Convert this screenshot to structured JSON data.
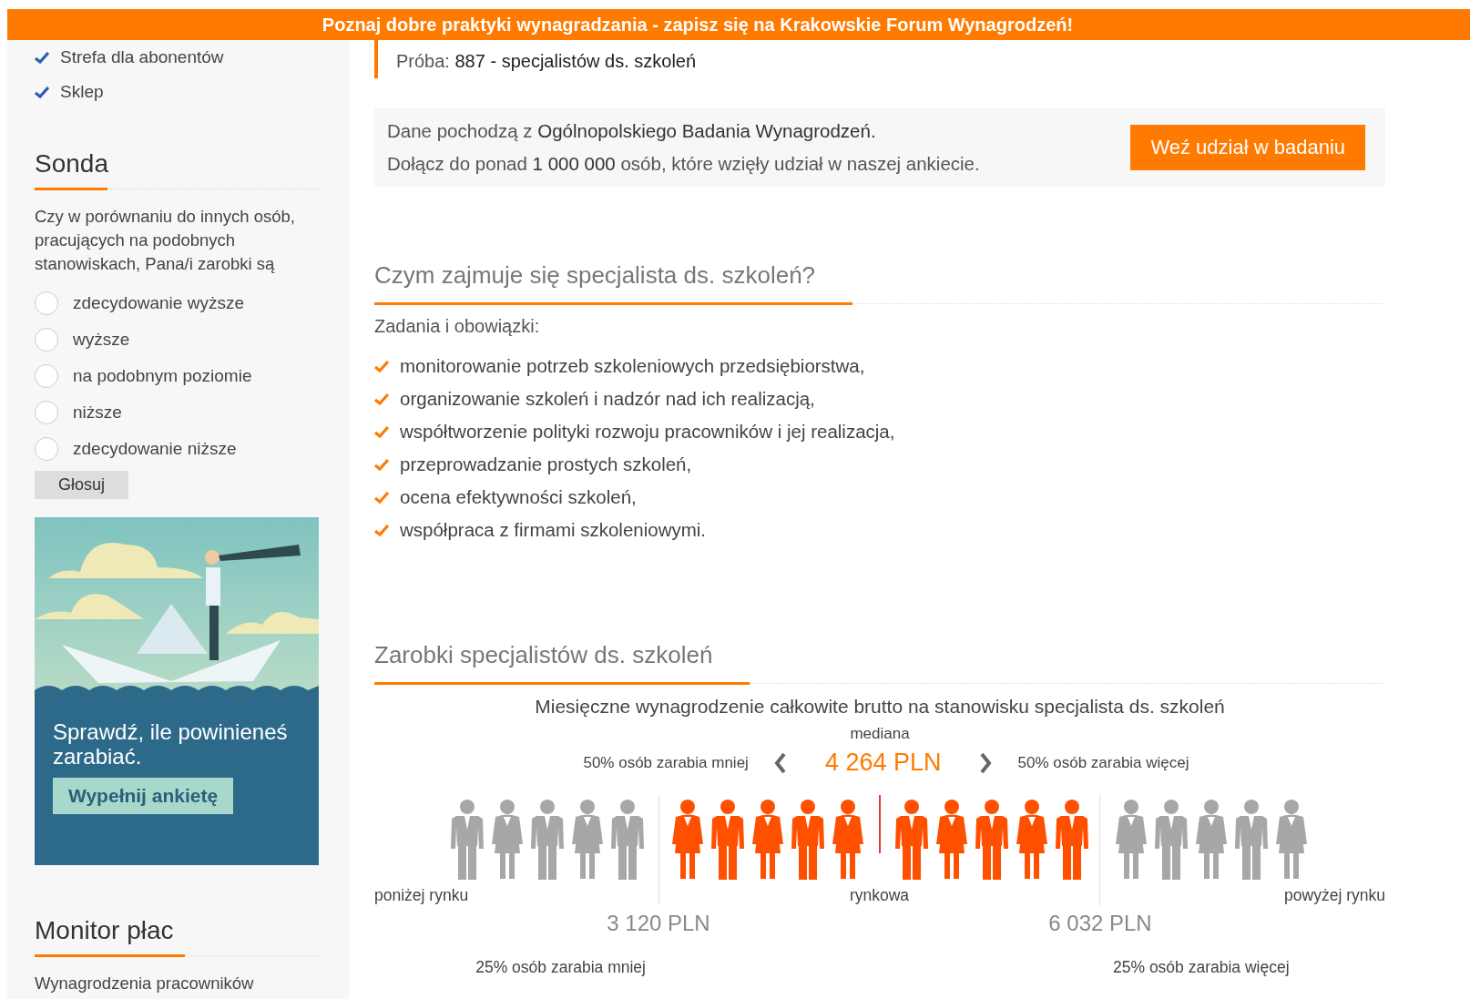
{
  "banner": {
    "text": "Poznaj dobre praktyki wynagradzania - zapisz się na Krakowskie Forum Wynagrodzeń!"
  },
  "sidebar": {
    "links": [
      "Strefa dla abonentów",
      "Sklep"
    ],
    "poll": {
      "title": "Sonda",
      "question": "Czy w porównaniu do innych osób, pracujących na podobnych stanowiskach, Pana/i zarobki są",
      "options": [
        {
          "label": "zdecydowanie wyższe",
          "selected": false
        },
        {
          "label": "wyższe",
          "selected": false
        },
        {
          "label": "na podobnym poziomie",
          "selected": false
        },
        {
          "label": "niższe",
          "selected": false
        },
        {
          "label": "zdecydowanie niższe",
          "selected": false
        }
      ],
      "button": "Głosuj"
    },
    "ad": {
      "text": "Sprawdź, ile powinieneś zarabiać.",
      "button": "Wypełnij ankietę"
    },
    "monitor": {
      "title": "Monitor płac",
      "text": "Wynagrodzenia pracowników"
    }
  },
  "sample": {
    "label": "Próba:",
    "value": "887 - specjalistów ds. szkoleń"
  },
  "info": {
    "lines": [
      "Dane pochodzą z **Ogólnopolskiego Badania Wynagrodzeń.**",
      "Dołącz do ponad **1 000 000** osób, które wzięły udział w naszej ankiecie."
    ],
    "button": "Weź udział w badaniu"
  },
  "duties": {
    "title": "Czym zajmuje się specjalista ds. szkoleń?",
    "subtitle": "Zadania i obowiązki:",
    "items": [
      "monitorowanie potrzeb szkoleniowych przedsiębiorstwa,",
      "organizowanie szkoleń i nadzór nad ich realizacją,",
      "współtworzenie polityki rozwoju pracowników i jej realizacja,",
      "przeprowadzanie prostych szkoleń,",
      "ocena efektywności szkoleń,",
      "współpraca z firmami szkoleniowymi."
    ]
  },
  "salary": {
    "title": "Zarobki specjalistów ds. szkoleń",
    "caption": "Miesięczne wynagrodzenie całkowite brutto na stanowisku specjalista ds. szkoleń",
    "median_label": "mediana",
    "median_value": "4 264 PLN",
    "less_50": "50% osób zarabia mniej",
    "more_50": "50% osób zarabia więcej",
    "figures": [
      {
        "kind": "man",
        "in_range": false
      },
      {
        "kind": "woman",
        "in_range": false
      },
      {
        "kind": "man",
        "in_range": false
      },
      {
        "kind": "woman",
        "in_range": false
      },
      {
        "kind": "man",
        "in_range": false
      },
      {
        "kind": "woman",
        "in_range": true
      },
      {
        "kind": "man",
        "in_range": true
      },
      {
        "kind": "woman",
        "in_range": true
      },
      {
        "kind": "man",
        "in_range": true
      },
      {
        "kind": "woman",
        "in_range": true
      },
      {
        "kind": "man",
        "in_range": true
      },
      {
        "kind": "woman",
        "in_range": true
      },
      {
        "kind": "man",
        "in_range": true
      },
      {
        "kind": "woman",
        "in_range": true
      },
      {
        "kind": "man",
        "in_range": true
      },
      {
        "kind": "woman",
        "in_range": false
      },
      {
        "kind": "man",
        "in_range": false
      },
      {
        "kind": "woman",
        "in_range": false
      },
      {
        "kind": "man",
        "in_range": false
      },
      {
        "kind": "woman",
        "in_range": false
      }
    ],
    "below_label": "poniżej rynku",
    "market_label": "rynkowa",
    "above_label": "powyżej rynku",
    "q1_value": "3 120 PLN",
    "q3_value": "6 032 PLN",
    "less_25": "25% osób zarabia mniej",
    "more_25": "25% osób zarabia więcej"
  }
}
